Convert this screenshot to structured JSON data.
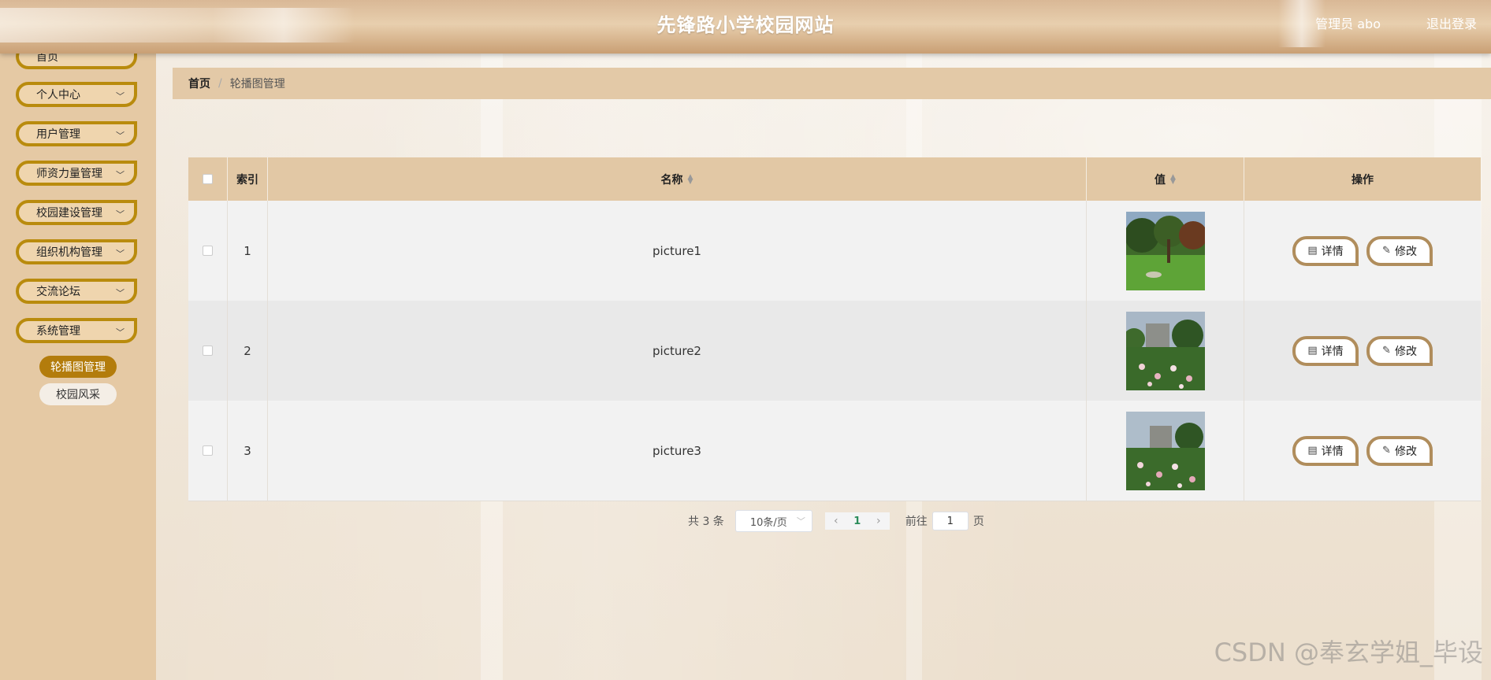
{
  "header": {
    "title": "先锋路小学校园网站",
    "user": "管理员 abo",
    "logout": "退出登录"
  },
  "sidebar": {
    "items": [
      {
        "label": "首页"
      },
      {
        "label": "个人中心"
      },
      {
        "label": "用户管理"
      },
      {
        "label": "师资力量管理"
      },
      {
        "label": "校园建设管理"
      },
      {
        "label": "组织机构管理"
      },
      {
        "label": "交流论坛"
      },
      {
        "label": "系统管理"
      }
    ],
    "submenu": [
      {
        "label": "轮播图管理",
        "active": true
      },
      {
        "label": "校园风采",
        "active": false
      }
    ]
  },
  "breadcrumb": {
    "home": "首页",
    "sep": "/",
    "current": "轮播图管理"
  },
  "table": {
    "headers": {
      "index": "索引",
      "name": "名称",
      "value": "值",
      "ops": "操作"
    },
    "rows": [
      {
        "index": "1",
        "name": "picture1",
        "detail": "详情",
        "edit": "修改"
      },
      {
        "index": "2",
        "name": "picture2",
        "detail": "详情",
        "edit": "修改"
      },
      {
        "index": "3",
        "name": "picture3",
        "detail": "详情",
        "edit": "修改"
      }
    ]
  },
  "pager": {
    "total": "共 3 条",
    "page_size": "10条/页",
    "current_page": "1",
    "goto_prefix": "前往",
    "goto_value": "1",
    "goto_suffix": "页"
  },
  "watermark": "CSDN @奉玄学姐_毕设",
  "colors": {
    "accent": "#b98b0d",
    "header_bg": "#d9b896",
    "sidebar_bg": "#e5c9a4"
  }
}
